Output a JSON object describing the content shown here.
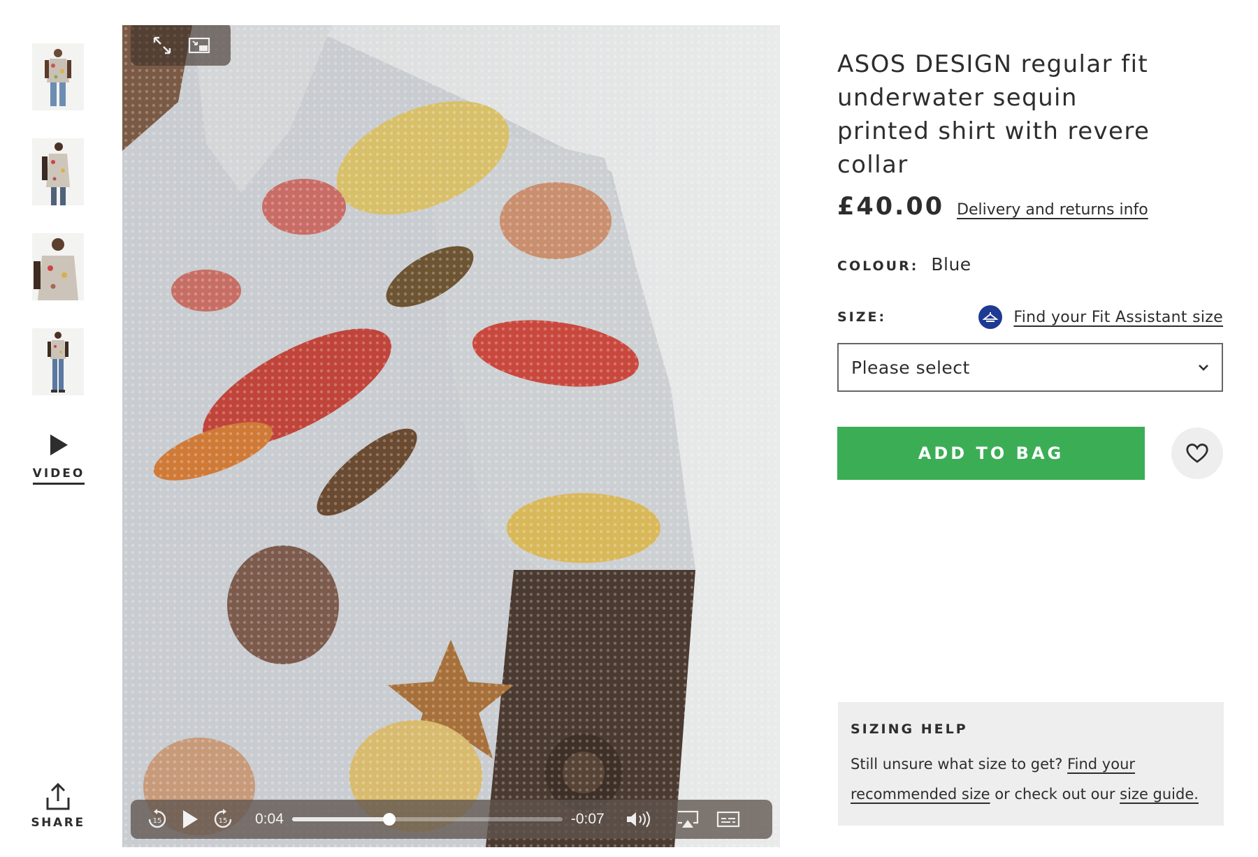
{
  "gallery": {
    "thumbnails": [
      {
        "name": "thumbnail-front"
      },
      {
        "name": "thumbnail-side"
      },
      {
        "name": "thumbnail-closeup"
      },
      {
        "name": "thumbnail-full-length"
      }
    ],
    "video_label": "VIDEO",
    "share_label": "SHARE"
  },
  "player": {
    "current_time": "0:04",
    "remaining_time": "-0:07",
    "progress_fraction": 0.36,
    "icons": [
      "fullscreen-icon",
      "picture-in-picture-icon",
      "rewind-15-icon",
      "play-icon",
      "forward-15-icon",
      "volume-icon",
      "airplay-icon",
      "captions-icon"
    ]
  },
  "product": {
    "title": "ASOS DESIGN regular fit underwater sequin printed shirt with revere collar",
    "price": "£40.00",
    "delivery_link": "Delivery and returns info",
    "colour_label": "COLOUR:",
    "colour_value": "Blue",
    "size_label": "SIZE:",
    "fit_assistant_link": "Find your Fit Assistant size",
    "size_select_value": "Please select",
    "add_to_bag": "ADD TO BAG"
  },
  "sizing_help": {
    "title": "SIZING HELP",
    "text_before": "Still unsure what size to get? ",
    "link_recommended": "Find your recommended size",
    "text_middle": " or check out our ",
    "link_size_guide": "size guide."
  },
  "colors": {
    "add_to_bag": "#3bae55",
    "fit_badge": "#1f3a93",
    "text": "#2d2d2d"
  }
}
